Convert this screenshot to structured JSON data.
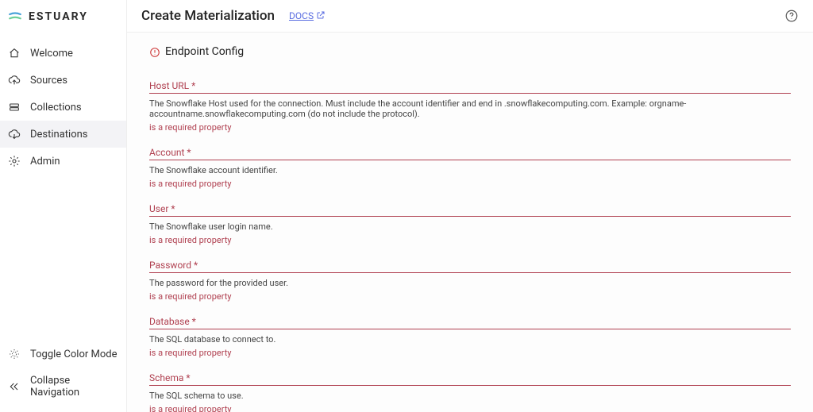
{
  "brand": {
    "name": "ESTUARY"
  },
  "sidebar": {
    "items": [
      {
        "label": "Welcome"
      },
      {
        "label": "Sources"
      },
      {
        "label": "Collections"
      },
      {
        "label": "Destinations"
      },
      {
        "label": "Admin"
      }
    ],
    "bottom": [
      {
        "label": "Toggle Color Mode"
      },
      {
        "label": "Collapse Navigation"
      }
    ]
  },
  "header": {
    "title": "Create Materialization",
    "docs": "DOCS"
  },
  "section": {
    "title": "Endpoint Config"
  },
  "fields": [
    {
      "label": "Host URL *",
      "desc": "The Snowflake Host used for the connection. Must include the account identifier and end in .snowflakecomputing.com. Example: orgname-accountname.snowflakecomputing.com (do not include the protocol).",
      "error": "is a required property"
    },
    {
      "label": "Account *",
      "desc": "The Snowflake account identifier.",
      "error": "is a required property"
    },
    {
      "label": "User *",
      "desc": "The Snowflake user login name.",
      "error": "is a required property"
    },
    {
      "label": "Password *",
      "desc": "The password for the provided user.",
      "error": "is a required property"
    },
    {
      "label": "Database *",
      "desc": "The SQL database to connect to.",
      "error": "is a required property"
    },
    {
      "label": "Schema *",
      "desc": "The SQL schema to use.",
      "error": "is a required property"
    }
  ]
}
